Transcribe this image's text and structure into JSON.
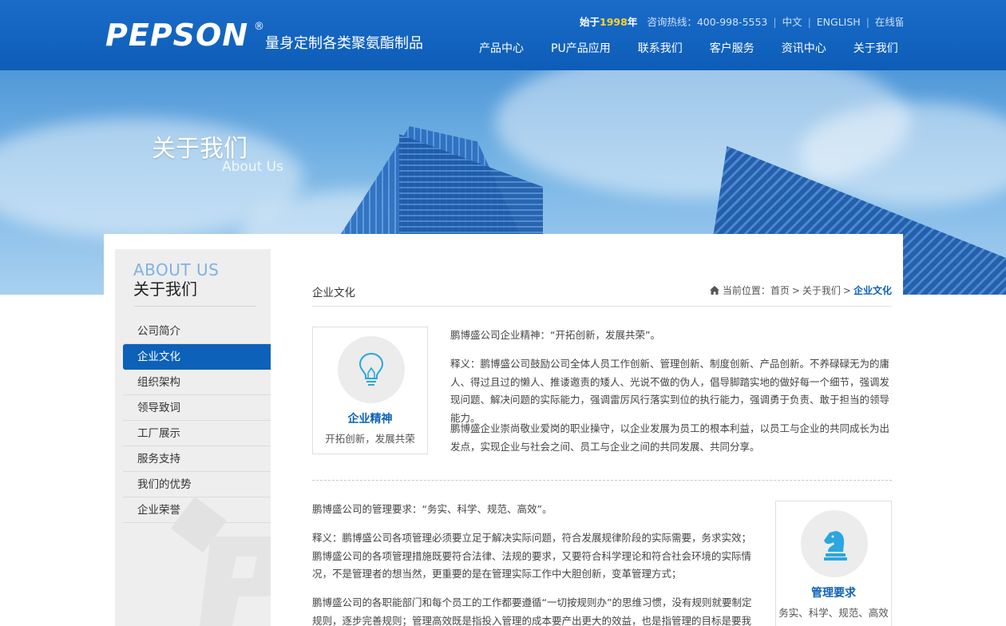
{
  "header": {
    "logo_text": "PEPSON",
    "logo_reg": "®",
    "slogan": "量身定制各类聚氨酯制品",
    "since_prefix": "始于",
    "since_year": "1998",
    "since_suffix": "年",
    "hotline_label": "咨询热线：",
    "hotline": "400-998-5553",
    "lang_cn": "中文",
    "lang_en": "ENGLISH",
    "online_msg": "在线留言"
  },
  "nav": [
    {
      "label": "产品中心"
    },
    {
      "label": "PU产品应用"
    },
    {
      "label": "联系我们"
    },
    {
      "label": "客户服务"
    },
    {
      "label": "资讯中心"
    },
    {
      "label": "关于我们"
    }
  ],
  "banner": {
    "title": "关于我们",
    "subtitle": "About Us"
  },
  "sidebar": {
    "title_en": "ABOUT US",
    "title_cn": "关于我们",
    "items": [
      {
        "label": "公司简介",
        "active": false
      },
      {
        "label": "企业文化",
        "active": true
      },
      {
        "label": "组织架构",
        "active": false
      },
      {
        "label": "领导致词",
        "active": false
      },
      {
        "label": "工厂展示",
        "active": false
      },
      {
        "label": "服务支持",
        "active": false
      },
      {
        "label": "我们的优势",
        "active": false
      },
      {
        "label": "企业荣誉",
        "active": false
      }
    ]
  },
  "main": {
    "title": "企业文化",
    "breadcrumb": {
      "label": "当前位置：",
      "home": "首页",
      "parent": "关于我们",
      "current": "企业文化",
      "sep": ">"
    },
    "spirit": {
      "icon": "lightbulb-icon",
      "title": "企业精神",
      "subtitle": "开拓创新，发展共荣",
      "p1": "鹏博盛公司企业精神：“开拓创新，发展共荣”。",
      "p2": "释义：鹏博盛公司鼓励公司全体人员工作创新、管理创新、制度创新、产品创新。不养碌碌无为的庸人、得过且过的懒人、推诿邀责的矮人、光说不做的伪人，倡导脚踏实地的做好每一个细节，强调发现问题、解决问题的实际能力，强调雷厉风行落实到位的执行能力，强调勇于负责、敢于担当的领导能力。",
      "p3": "鹏博盛企业崇尚敬业爱岗的职业操守，以企业发展为员工的根本利益，以员工与企业的共同成长为出发点，实现企业与社会之间、员工与企业之间的共同发展、共同分享。"
    },
    "management": {
      "icon": "chess-knight-icon",
      "title": "管理要求",
      "subtitle": "务实、科学、规范、高效",
      "p1": "鹏博盛公司的管理要求：“务实、科学、规范、高效”。",
      "p2": "释义：鹏博盛公司各项管理必须要立足于解决实际问题，符合发展规律阶段的实际需要，务求实效；鹏博盛公司的各项管理措施既要符合法律、法规的要求，又要符合科学理论和符合社会环境的实际情况，不是管理者的想当然，更重要的是在管理实际工作中大胆创新，变革管理方式；",
      "p3": "鹏博盛公司的各职能部门和每个员工的工作都要遵循“一切按规则办”的思维习惯，没有规则就要制定规则，逐步完善规则；管理高效既是指投入管理的成本要产出更大的效益，也是指管理的目标是要我们各级"
    }
  },
  "colors": {
    "brand_blue": "#0d61b9",
    "header_blue": "#1a6cc8",
    "year_yellow": "#ffd22a",
    "sidebar_bg": "#eeeeee"
  }
}
